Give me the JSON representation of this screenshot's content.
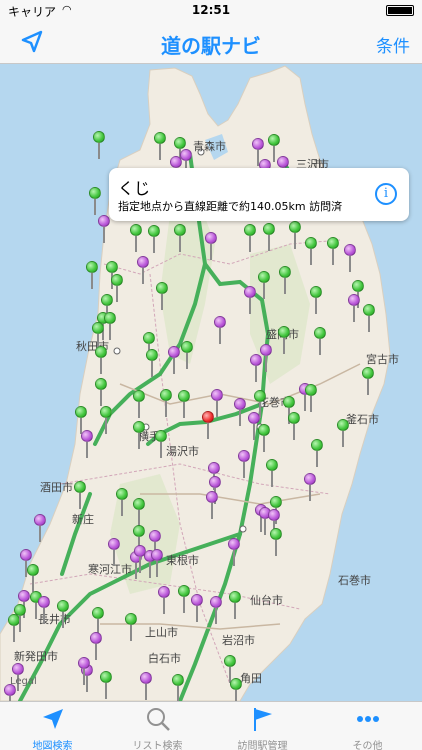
{
  "status_bar": {
    "carrier": "キャリア",
    "time": "12:51"
  },
  "nav_bar": {
    "title": "道の駅ナビ",
    "conditions_label": "条件",
    "locate_icon": "location-arrow-icon"
  },
  "callout": {
    "name": "くじ",
    "detail": "指定地点から直線距離で約140.05km 訪問済"
  },
  "map": {
    "legal_label": "Legal",
    "city_labels": [
      "青森市",
      "三沢市",
      "秋田市",
      "宮古市",
      "盛岡市",
      "花巻市",
      "釜石市",
      "湯沢市",
      "横手",
      "酒田市",
      "新庄",
      "石巻市",
      "仙台市",
      "東根市",
      "寒河江市",
      "長井市",
      "上山市",
      "岩沼市",
      "白石市",
      "新発田市",
      "角田",
      "市"
    ],
    "pin_colors": {
      "visited": "#b854d8",
      "unvisited": "#3fc43a",
      "selected": "#ee2a2a"
    }
  },
  "tabs": [
    {
      "label": "地図検索",
      "icon": "location-arrow-icon",
      "active": true
    },
    {
      "label": "リスト検索",
      "icon": "magnifier-icon",
      "active": false
    },
    {
      "label": "訪問駅管理",
      "icon": "flag-icon",
      "active": false
    },
    {
      "label": "その他",
      "icon": "more-dots-icon",
      "active": false
    }
  ]
}
